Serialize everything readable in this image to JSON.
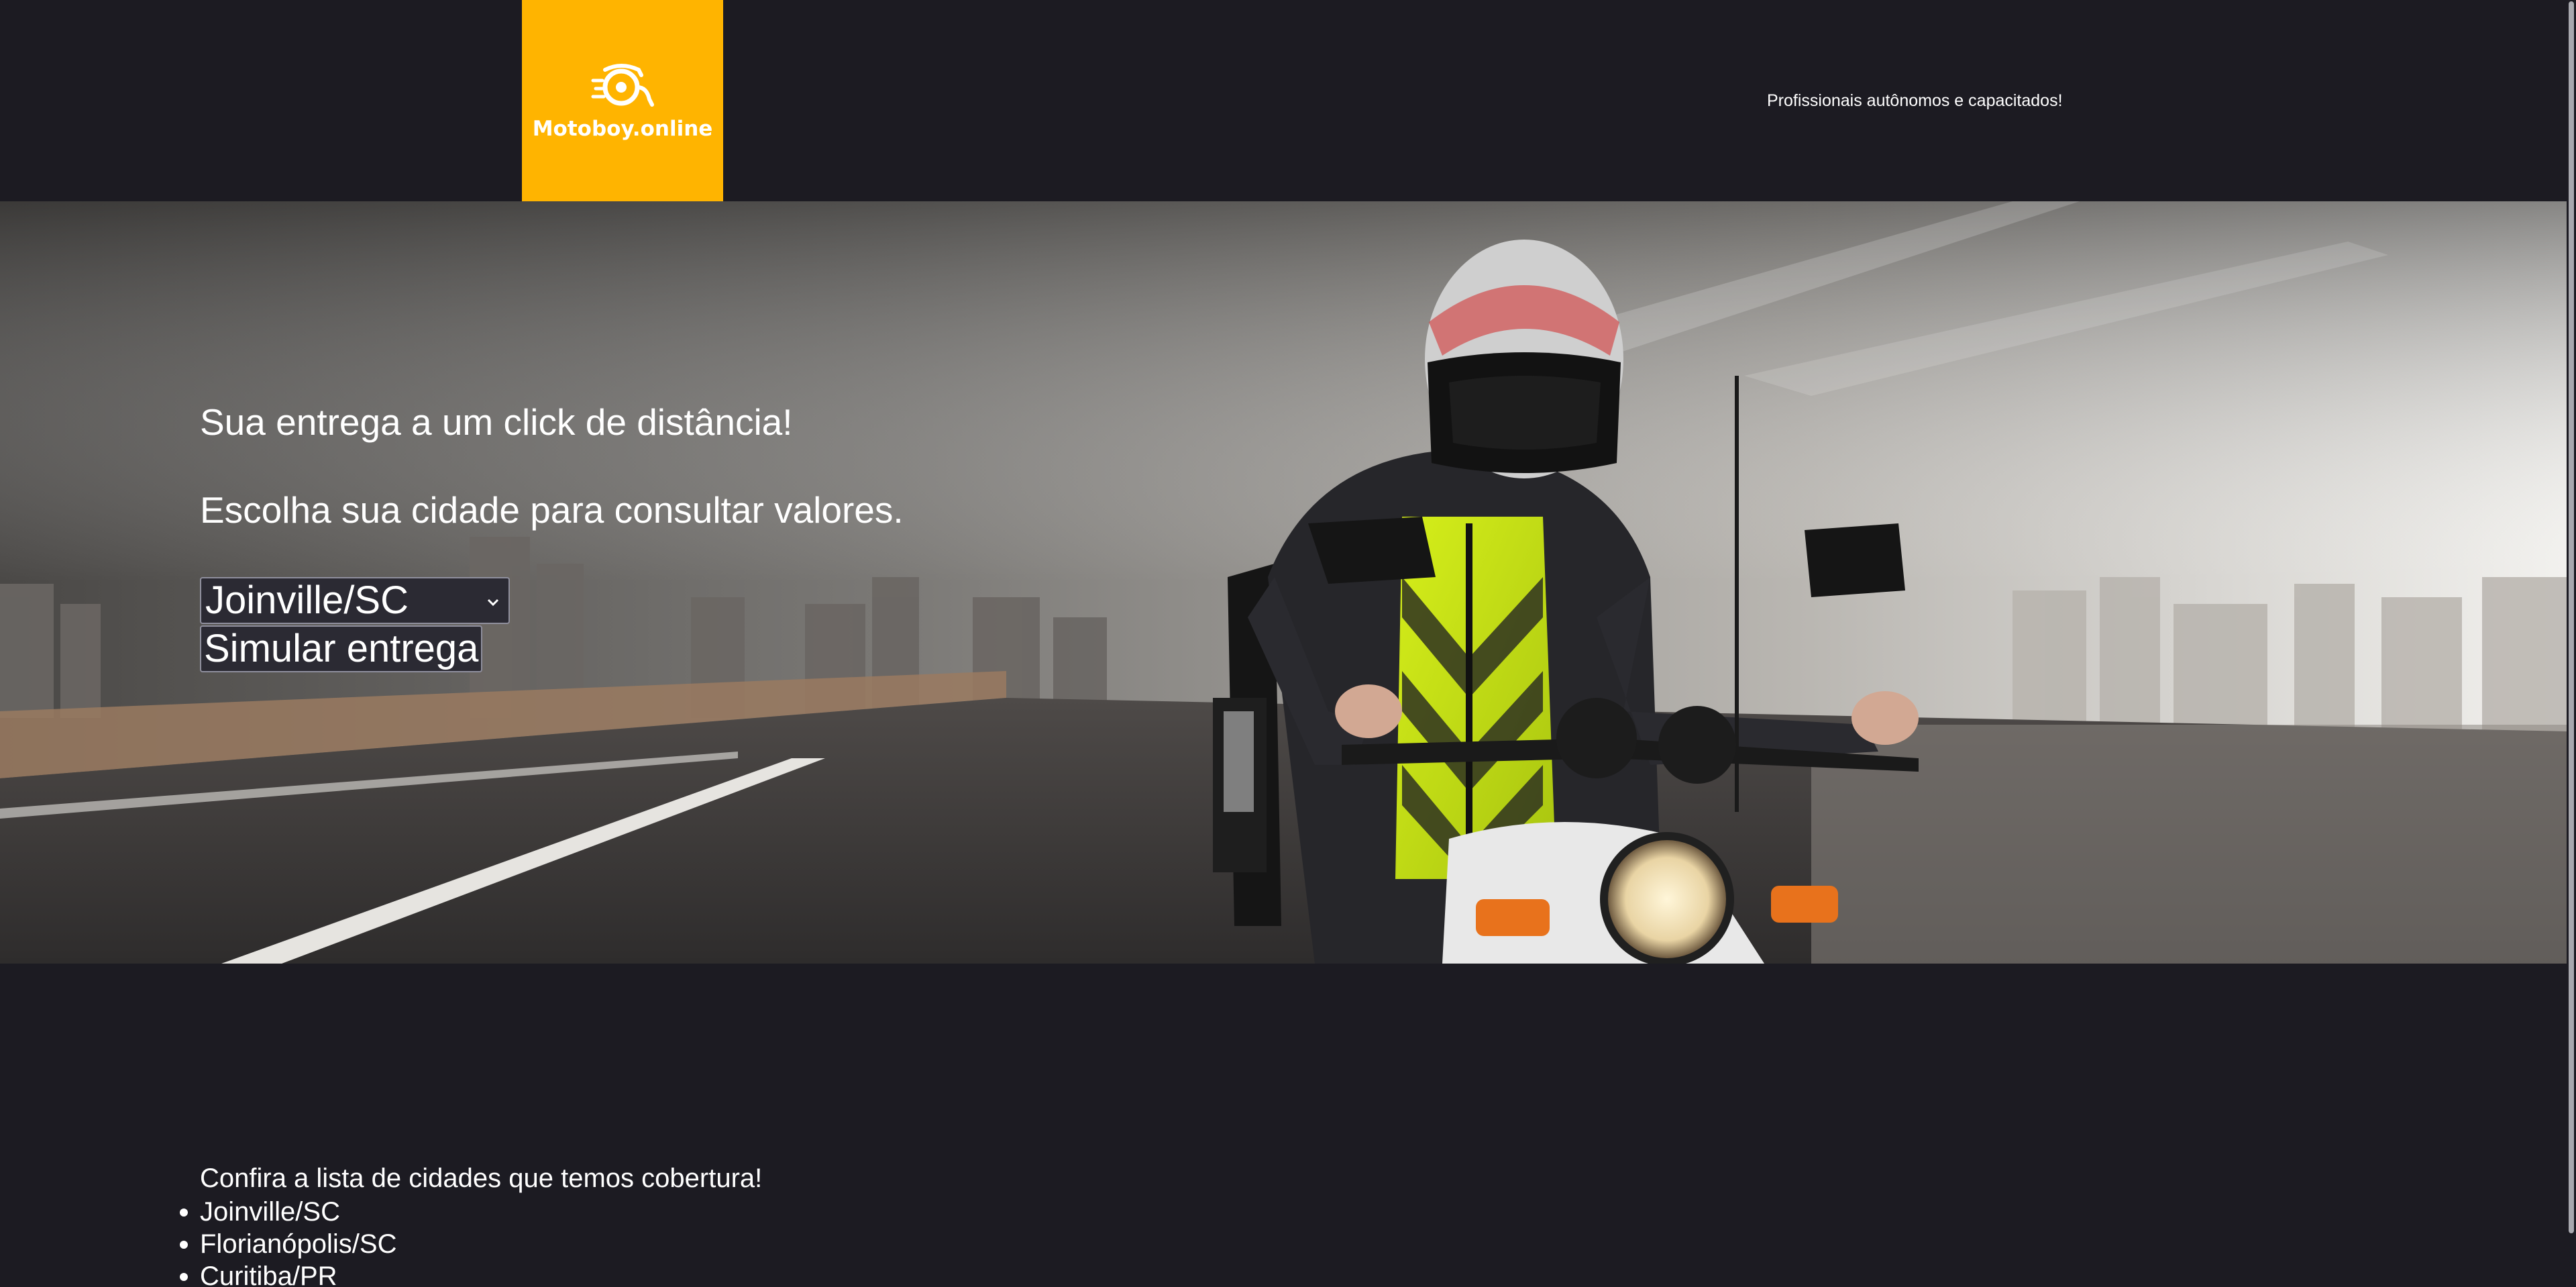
{
  "brand": {
    "name": "Motoboy.online",
    "logo_icon": "scooter-wheel-icon",
    "accent_color": "#ffb400",
    "background_color": "#1c1b22"
  },
  "header": {
    "tagline": "Profissionais autônomos e capacitados!"
  },
  "hero": {
    "headline": "Sua entrega a um click de distância!",
    "subheadline": "Escolha sua cidade para consultar valores.",
    "city_select": {
      "selected": "Joinville/SC",
      "icon": "chevron-down-icon"
    },
    "simulate_button": "Simular entrega",
    "image": "motorcycle-courier-photo"
  },
  "coverage": {
    "title": "Confira a lista de cidades que temos cobertura!",
    "cities": [
      "Joinville/SC",
      "Florianópolis/SC",
      "Curitiba/PR"
    ]
  }
}
